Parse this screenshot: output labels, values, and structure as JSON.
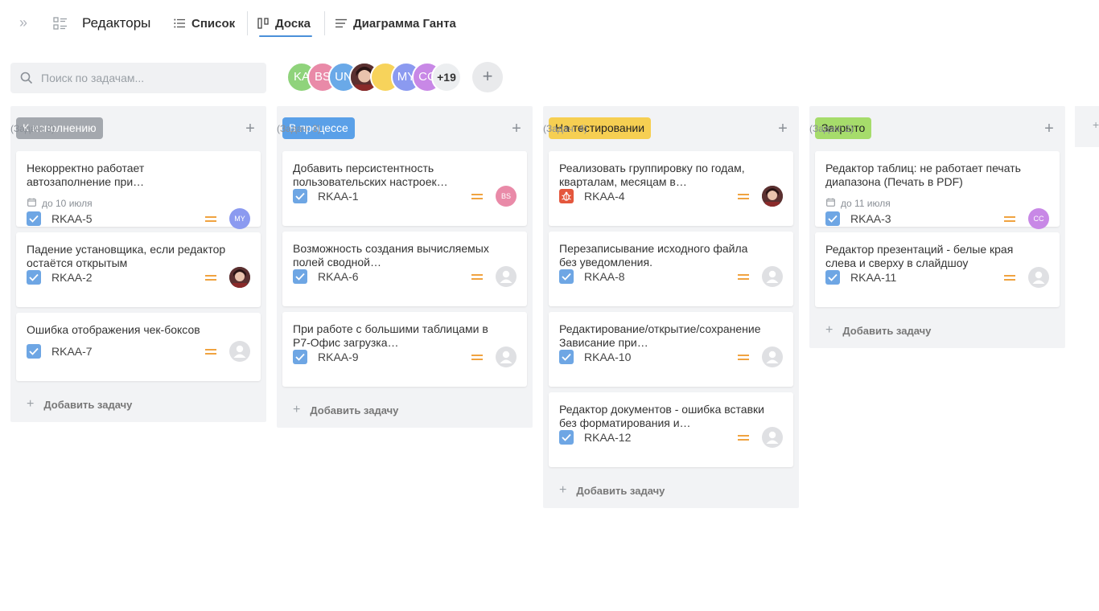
{
  "project": {
    "title": "Редакторы"
  },
  "tabs": [
    {
      "label": "Список"
    },
    {
      "label": "Доска"
    },
    {
      "label": "Диаграмма Ганта"
    }
  ],
  "search": {
    "placeholder": "Поиск по задачам..."
  },
  "members": [
    {
      "initials": "KA",
      "color": "#8fd37b"
    },
    {
      "initials": "BS",
      "color": "#e98aa8"
    },
    {
      "initials": "UN",
      "color": "#6aa9e8"
    },
    {
      "initials": "",
      "color": "#4b2a2a",
      "photo": true
    },
    {
      "initials": "",
      "color": "#f7d35b"
    },
    {
      "initials": "MY",
      "color": "#8b9af0"
    },
    {
      "initials": "CC",
      "color": "#c888e6"
    }
  ],
  "members_more": "+19",
  "columns": [
    {
      "status": "К исполнению",
      "status_bg": "#a4a8ae",
      "status_fg": "#ffffff",
      "count": "(Задач: 3)",
      "add_task": "Добавить задачу",
      "cards": [
        {
          "title": "Некорректно работает автозаполнение при…",
          "date": "до 10 июля",
          "key": "RKAA-5",
          "type": "task",
          "assignee": "MY",
          "assignee_color": "#8b9af0"
        },
        {
          "title": "Падение установщика, если редактор остаётся открытым",
          "key": "RKAA-2",
          "type": "task",
          "assignee": "",
          "assignee_color": "photo"
        },
        {
          "title": "Ошибка отображения чек-боксов",
          "key": "RKAA-7",
          "type": "task",
          "assignee": "",
          "assignee_color": "empty"
        }
      ]
    },
    {
      "status": "В процессе",
      "status_bg": "#5aa0e8",
      "status_fg": "#ffffff",
      "count": "(Задач: 3)",
      "add_task": "Добавить задачу",
      "cards": [
        {
          "title": "Добавить персистентность пользовательских настроек…",
          "key": "RKAA-1",
          "type": "task",
          "assignee": "BS",
          "assignee_color": "#e98aa8"
        },
        {
          "title": "Возможность создания вычисляемых полей сводной…",
          "key": "RKAA-6",
          "type": "task",
          "assignee": "",
          "assignee_color": "empty"
        },
        {
          "title": "При работе с большими таблицами в Р7-Офис загрузка…",
          "key": "RKAA-9",
          "type": "task",
          "assignee": "",
          "assignee_color": "empty"
        }
      ]
    },
    {
      "status": "На тестировании",
      "status_bg": "#f6cf52",
      "status_fg": "#222222",
      "count": "(Задач: 4)",
      "add_task": "Добавить задачу",
      "cards": [
        {
          "title": "Реализовать группировку по годам, кварталам, месяцам в…",
          "key": "RKAA-4",
          "type": "bug",
          "assignee": "",
          "assignee_color": "photo"
        },
        {
          "title": "Перезаписывание исходного файла без уведомления.",
          "key": "RKAA-8",
          "type": "task",
          "assignee": "",
          "assignee_color": "empty"
        },
        {
          "title": "Редактирование/открытие/сохранение Зависание при…",
          "key": "RKAA-10",
          "type": "task",
          "assignee": "",
          "assignee_color": "empty"
        },
        {
          "title": "Редактор документов - ошибка вставки без форматирования и…",
          "key": "RKAA-12",
          "type": "task",
          "assignee": "",
          "assignee_color": "empty"
        }
      ]
    },
    {
      "status": "Закрыто",
      "status_bg": "#a6dc6b",
      "status_fg": "#222222",
      "count": "(Задач: 2)",
      "add_task": "Добавить задачу",
      "cards": [
        {
          "title": "Редактор таблиц: не работает печать диапазона (Печать в PDF)",
          "date": "до 11 июля",
          "key": "RKAA-3",
          "type": "task",
          "assignee": "CC",
          "assignee_color": "#c888e6"
        },
        {
          "title": "Редактор презентаций - белые края слева и сверху в слайдшоу",
          "key": "RKAA-11",
          "type": "task",
          "assignee": "",
          "assignee_color": "empty"
        }
      ]
    }
  ],
  "icons": {
    "expand": "double-chevron-right-icon",
    "project": "project-list-icon",
    "search": "search-icon",
    "calendar": "calendar-icon",
    "priority": "priority-medium-icon"
  }
}
